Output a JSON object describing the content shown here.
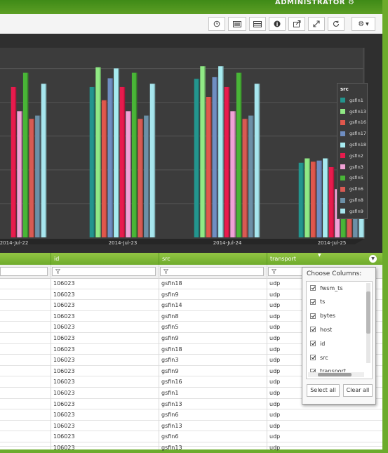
{
  "header": {
    "user": "ADMINISTRATOR",
    "menu_icon": "gear-icon"
  },
  "toolbar": {
    "buttons": [
      "clock-icon",
      "image-icon",
      "table-icon",
      "info-icon",
      "export-icon",
      "expand-icon",
      "refresh-icon",
      "settings-dropdown-icon"
    ]
  },
  "chart_data": {
    "type": "bar",
    "categories": [
      "2014-Jul-22",
      "2014-Jul-23",
      "2014-Jul-24",
      "2014-Jul-25"
    ],
    "legend_title": "src",
    "legend_position": "right",
    "grid": true,
    "series": [
      {
        "name": "gsfin1",
        "color": "#23958e",
        "values": [
          null,
          1370,
          1445,
          680
        ]
      },
      {
        "name": "gsfin13",
        "color": "#90e985",
        "values": [
          null,
          1550,
          1560,
          720
        ]
      },
      {
        "name": "gsfin16",
        "color": "#e0574c",
        "values": [
          null,
          1250,
          1280,
          690
        ]
      },
      {
        "name": "gsfin17",
        "color": "#6f8ec2",
        "values": [
          null,
          1450,
          1460,
          700
        ]
      },
      {
        "name": "gsfin18",
        "color": "#a7ebf0",
        "values": [
          null,
          1540,
          1560,
          720
        ]
      },
      {
        "name": "gsfin2",
        "color": "#e81b4d",
        "values": [
          1370,
          1370,
          1370,
          640
        ]
      },
      {
        "name": "gsfin3",
        "color": "#f0a2d6",
        "values": [
          1150,
          1150,
          1150,
          440
        ]
      },
      {
        "name": "gsfin5",
        "color": "#49b537",
        "values": [
          1500,
          1500,
          1500,
          580
        ]
      },
      {
        "name": "gsfin6",
        "color": "#d95a53",
        "values": [
          1080,
          1080,
          1080,
          530
        ]
      },
      {
        "name": "gsfin8",
        "color": "#6c90a7",
        "values": [
          1110,
          1110,
          1110,
          540
        ]
      },
      {
        "name": "gsfin9",
        "color": "#a7e6ee",
        "values": [
          1400,
          1400,
          1400,
          670
        ]
      }
    ]
  },
  "table": {
    "columns": [
      "",
      "id",
      "src",
      "transport"
    ],
    "rows": [
      [
        "",
        "106023",
        "gsfin18",
        "udp"
      ],
      [
        "",
        "106023",
        "gsfin9",
        "udp"
      ],
      [
        "",
        "106023",
        "gsfin14",
        "udp"
      ],
      [
        "",
        "106023",
        "gsfin8",
        "udp"
      ],
      [
        "",
        "106023",
        "gsfin5",
        "udp"
      ],
      [
        "",
        "106023",
        "gsfin9",
        "udp"
      ],
      [
        "",
        "106023",
        "gsfin18",
        "udp"
      ],
      [
        "",
        "106023",
        "gsfin3",
        "udp"
      ],
      [
        "",
        "106023",
        "gsfin9",
        "udp"
      ],
      [
        "",
        "106023",
        "gsfin16",
        "udp"
      ],
      [
        "",
        "106023",
        "gsfin1",
        "udp"
      ],
      [
        "",
        "106023",
        "gsfin13",
        "udp"
      ],
      [
        "",
        "106023",
        "gsfin6",
        "udp"
      ],
      [
        "",
        "106023",
        "gsfin13",
        "udp"
      ],
      [
        "",
        "106023",
        "gsfin6",
        "udp"
      ],
      [
        "",
        "106023",
        "gsfin13",
        "udp"
      ]
    ]
  },
  "column_chooser": {
    "title": "Choose Columns:",
    "items": [
      "fwsm_ts",
      "ts",
      "bytes",
      "host",
      "id",
      "src",
      "transport"
    ],
    "select_all": "Select all",
    "clear_all": "Clear all"
  }
}
